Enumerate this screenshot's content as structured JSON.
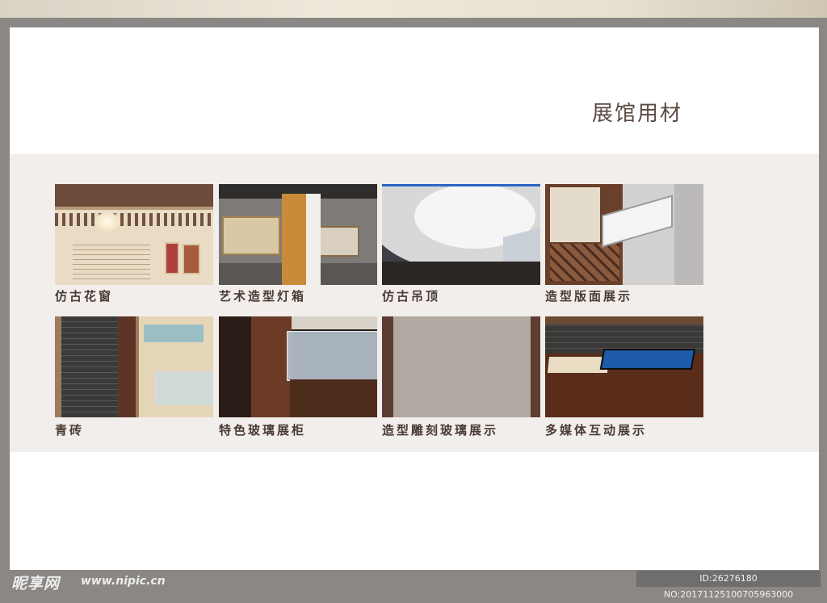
{
  "page": {
    "title": "展馆用材"
  },
  "items": [
    {
      "label": "仿古花窗"
    },
    {
      "label": "艺术造型灯箱"
    },
    {
      "label": "仿古吊顶"
    },
    {
      "label": "造型版面展示"
    },
    {
      "label": "青砖"
    },
    {
      "label": "特色玻璃展柜"
    },
    {
      "label": "造型雕刻玻璃展示"
    },
    {
      "label": "多媒体互动展示"
    }
  ],
  "watermark": {
    "logo": "昵享网",
    "url": "www.nipic.cn",
    "id_text": "ID:26276180 NO:20171125100705963000"
  }
}
